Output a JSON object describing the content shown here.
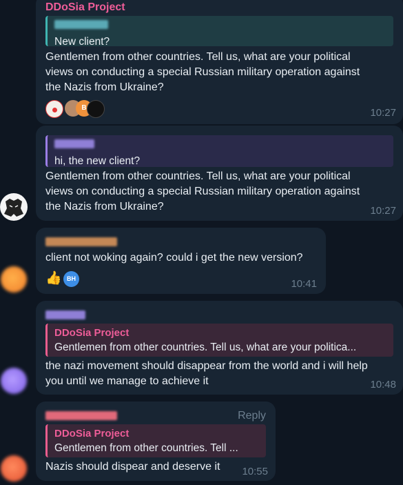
{
  "colors": {
    "background": "#0e1621",
    "bubble": "#182533",
    "sender_pink": "#ee5d98",
    "reply_teal_bar": "#3fb5b2",
    "reply_purple_bar": "#9b7ee6",
    "reply_pink_bar": "#e95d8e",
    "time": "#6d7f8f"
  },
  "messages": [
    {
      "sender": "DDoSia Project",
      "reply_text": "New client?",
      "text_lines": [
        "Gentlemen from other countries. Tell us, what are your political",
        "views on conducting a special Russian military operation against",
        "the Nazis from Ukraine?"
      ],
      "reactions": [
        "clown-icon",
        "avatar-icon",
        "avatar-B-icon",
        "avatar-dark-icon"
      ],
      "reaction_avatar_letter": "B",
      "time": "10:27"
    },
    {
      "reply_text": "hi, the new client?",
      "text_lines": [
        "Gentlemen from other countries. Tell us, what are your political",
        "views on conducting a special Russian military operation against",
        "the Nazis from Ukraine?"
      ],
      "time": "10:27"
    },
    {
      "text": "client not woking again? could i get the new version?",
      "reactions": [
        "thumbs-up-icon",
        "avatar-BH-icon"
      ],
      "reaction_avatar_letters": "BH",
      "time": "10:41"
    },
    {
      "reply_name": "DDoSia Project",
      "reply_text": "Gentlemen from other countries. Tell us, what are your politica...",
      "text_lines": [
        "the nazi movement should disappear from the world and i will help",
        "you until we manage to achieve it"
      ],
      "time": "10:48"
    },
    {
      "action": "Reply",
      "reply_name": "DDoSia Project",
      "reply_text": "Gentlemen from other countries. Tell ...",
      "text": "Nazis should dispear and deserve it",
      "time": "10:55"
    }
  ]
}
